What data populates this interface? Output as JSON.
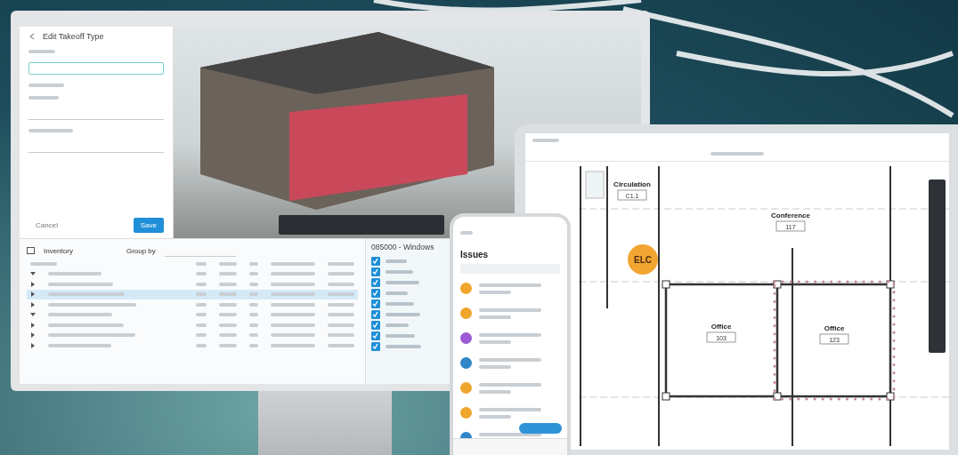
{
  "monitor": {
    "takeoff_panel": {
      "title": "Edit Takeoff Type",
      "buttons": [
        {
          "label": "Cancel",
          "kind": "secondary"
        },
        {
          "label": "Save",
          "kind": "primary"
        }
      ]
    },
    "inventory": {
      "title": "Inventory",
      "group_by_label": "Group by",
      "rows": [
        {
          "selected": false,
          "expanded": true
        },
        {
          "selected": false,
          "expanded": false
        },
        {
          "selected": true,
          "expanded": false
        },
        {
          "selected": false,
          "expanded": false
        },
        {
          "selected": false,
          "expanded": true
        },
        {
          "selected": false,
          "expanded": false
        },
        {
          "selected": false,
          "expanded": false
        },
        {
          "selected": false,
          "expanded": false
        }
      ]
    },
    "category_panel": {
      "title": "085000 - Windows",
      "items": [
        {
          "checked": true
        },
        {
          "checked": true
        },
        {
          "checked": true
        },
        {
          "checked": true
        },
        {
          "checked": true
        },
        {
          "checked": true
        },
        {
          "checked": true
        },
        {
          "checked": true
        },
        {
          "checked": true
        }
      ]
    }
  },
  "phone": {
    "title": "Issues",
    "issues": [
      {
        "color": "#f0a52c"
      },
      {
        "color": "#f0a52c"
      },
      {
        "color": "#9b5ad6"
      },
      {
        "color": "#2f86c8"
      },
      {
        "color": "#f0a52c"
      },
      {
        "color": "#f0a52c"
      },
      {
        "color": "#2f86c8"
      }
    ]
  },
  "tablet": {
    "rooms": [
      {
        "name": "Circulation",
        "number": "C1.1"
      },
      {
        "name": "Conference",
        "number": "117"
      },
      {
        "name": "Office",
        "number": "103"
      },
      {
        "name": "Office",
        "number": "123"
      }
    ],
    "marker": "ELC"
  }
}
